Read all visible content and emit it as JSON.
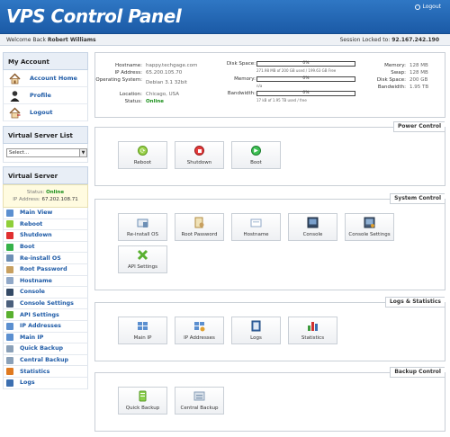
{
  "header": {
    "title": "VPS Control Panel",
    "logout_label": "Logout"
  },
  "subbar": {
    "welcome_label": "Welcome Back",
    "user_name": "Robert Williams",
    "locked_label": "Session Locked to:",
    "locked_ip": "92.167.242.190"
  },
  "sidebar": {
    "account_title": "My Account",
    "account_items": [
      {
        "label": "Account Home",
        "icon": "home-icon"
      },
      {
        "label": "Profile",
        "icon": "person-icon"
      },
      {
        "label": "Logout",
        "icon": "home-exit-icon"
      }
    ],
    "vsl_title": "Virtual Server List",
    "select_value": "Select...",
    "vs_title": "Virtual Server",
    "status_label": "Status:",
    "status_value": "Online",
    "ip_label": "IP Address:",
    "ip_value": "67.202.108.71",
    "nav": [
      {
        "label": "Main View",
        "icon": "grid-icon",
        "color": "#5b8fd0"
      },
      {
        "label": "Reboot",
        "icon": "reboot-icon",
        "color": "#8fcf3a"
      },
      {
        "label": "Shutdown",
        "icon": "shutdown-icon",
        "color": "#e03030"
      },
      {
        "label": "Boot",
        "icon": "boot-icon",
        "color": "#36b24a"
      },
      {
        "label": "Re-install OS",
        "icon": "reinstall-icon",
        "color": "#6d8fb5"
      },
      {
        "label": "Root Password",
        "icon": "root-password-icon",
        "color": "#c8a060"
      },
      {
        "label": "Hostname",
        "icon": "hostname-icon",
        "color": "#90a8c8"
      },
      {
        "label": "Console",
        "icon": "console-icon",
        "color": "#344a66"
      },
      {
        "label": "Console Settings",
        "icon": "console-settings-icon",
        "color": "#4a5f7c"
      },
      {
        "label": "API Settings",
        "icon": "api-icon",
        "color": "#59b030"
      },
      {
        "label": "IP Addresses",
        "icon": "ip-addresses-icon",
        "color": "#5b8fd0"
      },
      {
        "label": "Main IP",
        "icon": "main-ip-icon",
        "color": "#5b8fd0"
      },
      {
        "label": "Quick Backup",
        "icon": "quick-backup-icon",
        "color": "#8aa0b8"
      },
      {
        "label": "Central Backup",
        "icon": "central-backup-icon",
        "color": "#8aa0b8"
      },
      {
        "label": "Statistics",
        "icon": "statistics-icon",
        "color": "#e07a20"
      },
      {
        "label": "Logs",
        "icon": "logs-icon",
        "color": "#3c6fb0"
      }
    ]
  },
  "info": {
    "hostname_label": "Hostname:",
    "hostname_value": "happy.techgage.com",
    "ip_label": "IP Address:",
    "ip_value": "65.200.105.70",
    "os_label": "Operating System:",
    "os_value": "Debian 3.1 32bit",
    "location_label": "Location:",
    "location_value": "Chicago, USA",
    "status_label": "Status:",
    "status_value": "Online",
    "disk_label": "Disk Space:",
    "disk_pct": "0%",
    "disk_sub": "271.98 MB of 200 GB used / 199.63 GB Free",
    "disk_fraction": 0.0,
    "memory_label": "Memory:",
    "memory_pct": "0%",
    "memory_sub": "n/a",
    "memory_fraction": 0.0,
    "bandwidth_label": "Bandwidth:",
    "bandwidth_pct": "0%",
    "bandwidth_sub": "17 kB of 1.95 TB used / free",
    "bandwidth_fraction": 0.0,
    "r_memory_label": "Memory:",
    "r_memory_value": "128 MB",
    "r_swap_label": "Swap:",
    "r_swap_value": "128 MB",
    "r_disk_label": "Disk Space:",
    "r_disk_value": "200 GB",
    "r_bw_label": "Bandwidth:",
    "r_bw_value": "1.95 TB"
  },
  "power": {
    "title": "Power Control",
    "buttons": [
      "Reboot",
      "Shutdown",
      "Boot"
    ]
  },
  "system": {
    "title": "System Control",
    "buttons": [
      "Re-install OS",
      "Root Password",
      "Hostname",
      "Console",
      "Console Settings",
      "API Settings"
    ]
  },
  "logs": {
    "title": "Logs & Statistics",
    "buttons": [
      "Main IP",
      "IP Addresses",
      "Logs",
      "Statistics"
    ]
  },
  "backup": {
    "title": "Backup Control",
    "buttons": [
      "Quick Backup",
      "Central Backup"
    ]
  }
}
